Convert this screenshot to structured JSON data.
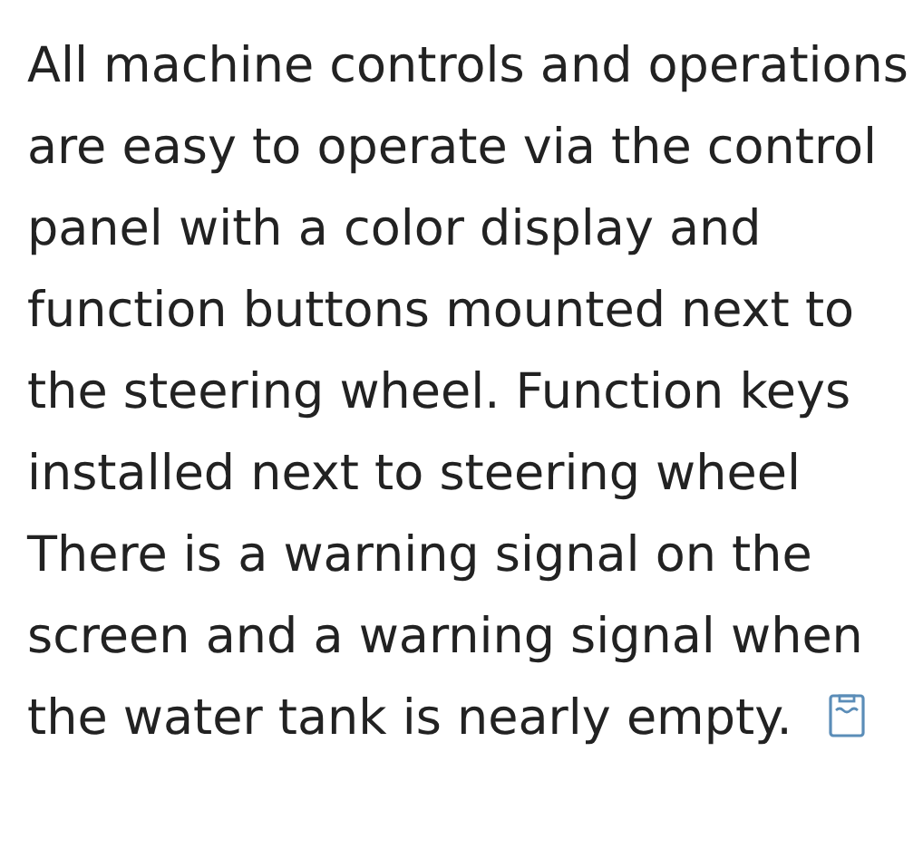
{
  "paragraph": {
    "text": "All machine controls and operations are easy to operate via the control panel with a color display and function buttons mounted next to the steering wheel. Function keys installed next to steering wheel There is a warning signal on the screen and a warning signal when the water tank is nearly empty."
  }
}
